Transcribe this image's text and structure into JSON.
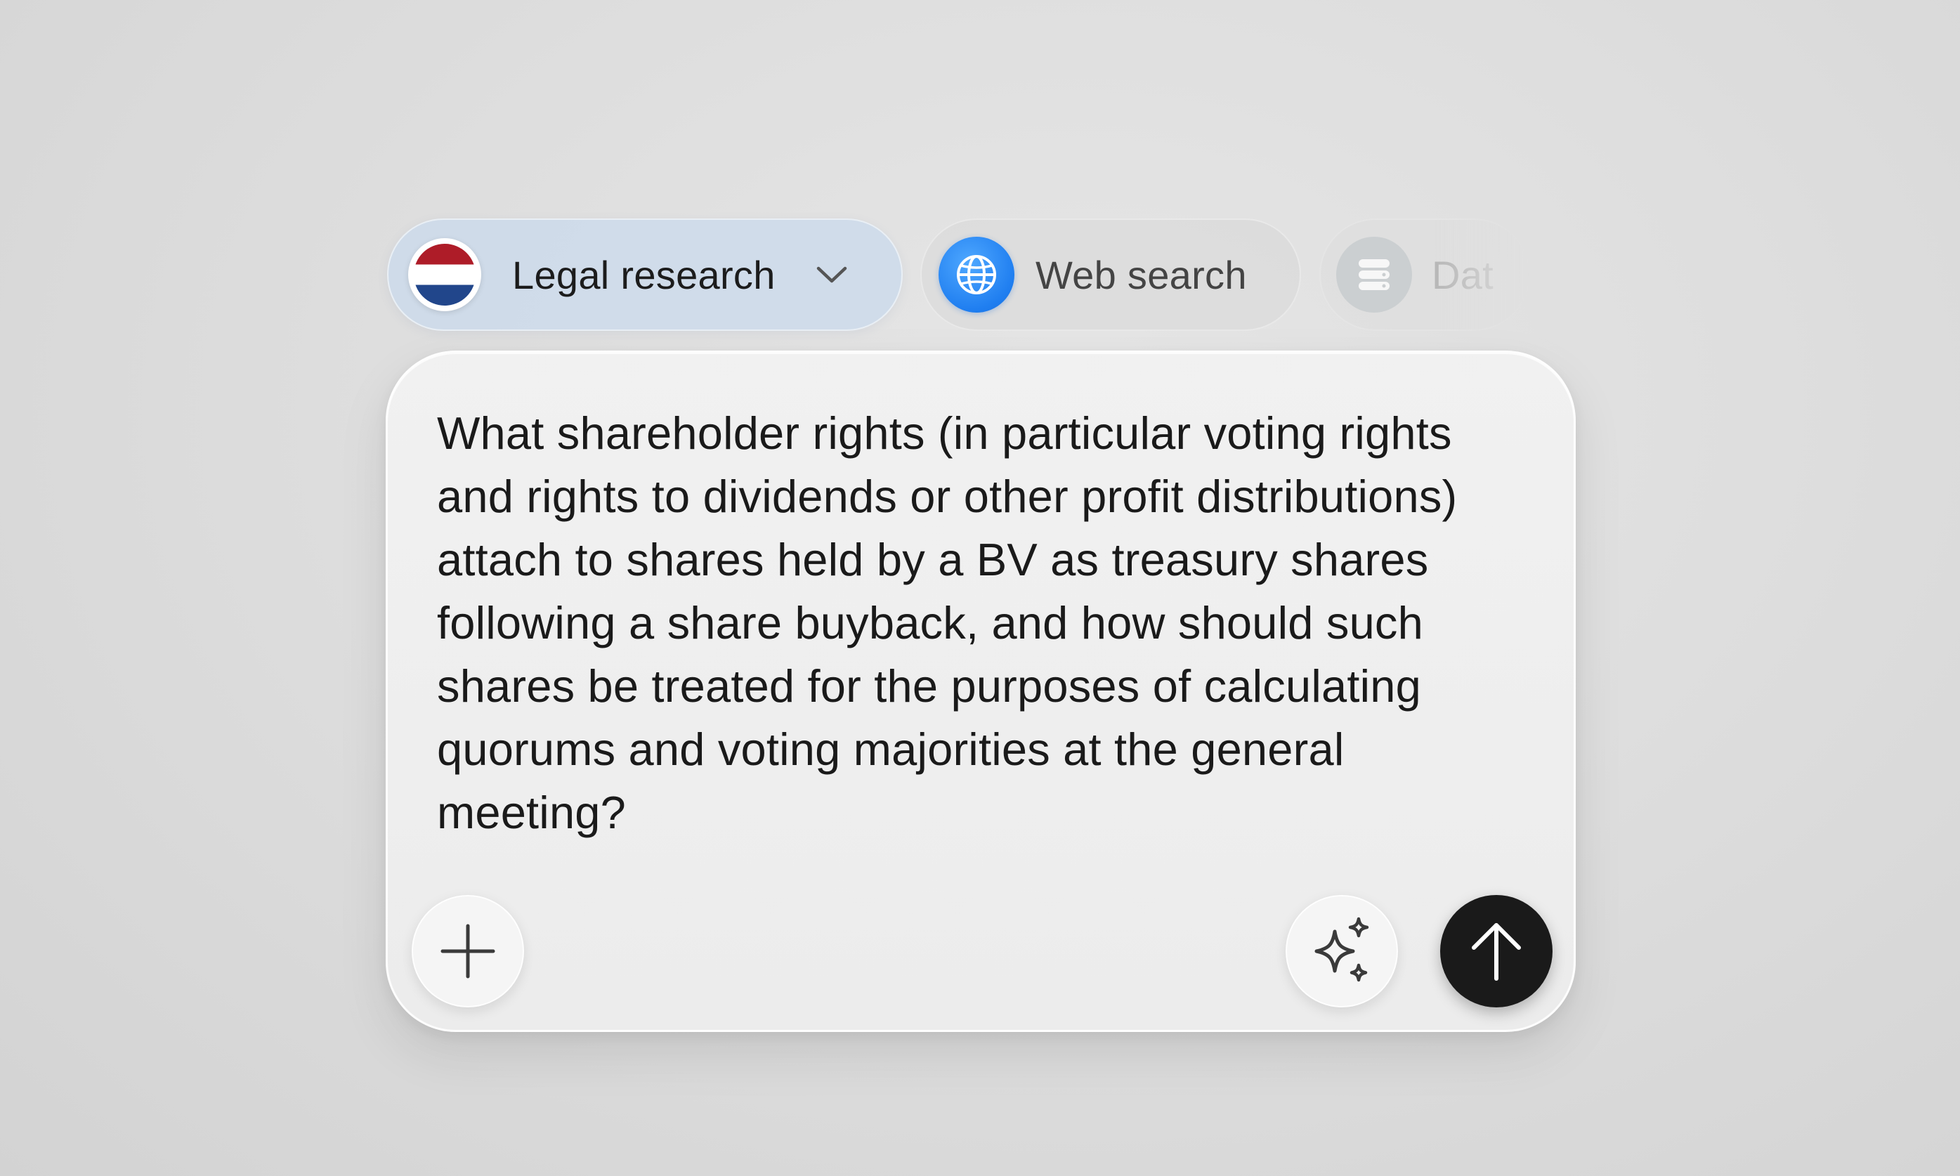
{
  "modes": {
    "legal": {
      "label": "Legal research",
      "flag": "netherlands-flag",
      "selected": true
    },
    "web": {
      "label": "Web search",
      "icon": "globe-icon"
    },
    "data": {
      "label": "Dat",
      "icon": "database-icon"
    }
  },
  "composer": {
    "prompt": "What shareholder rights (in particular voting rights and rights to dividends or other profit distributions) attach to shares held by a BV as treasury shares following a share buyback, and how should such shares be treated for the purposes of calculating quorums and voting majorities at the general meeting?",
    "add_icon": "plus-icon",
    "enhance_icon": "sparkles-icon",
    "send_icon": "arrow-up-icon"
  },
  "colors": {
    "selected_chip": "#ccdaeb",
    "globe_blue": "#1f7ef0",
    "send_button": "#1a1a1a",
    "flag_red": "#ae1c28",
    "flag_blue": "#21468b"
  }
}
